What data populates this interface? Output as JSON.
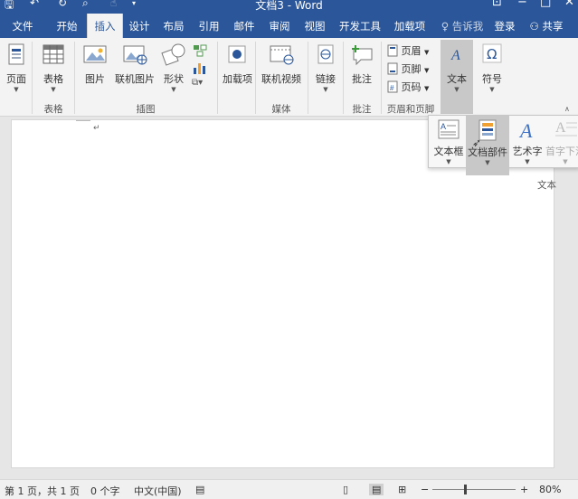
{
  "window": {
    "title": "文档3 - Word"
  },
  "tabs": {
    "file": "文件",
    "home": "开始",
    "insert": "插入",
    "design": "设计",
    "layout": "布局",
    "references": "引用",
    "mailings": "邮件",
    "review": "审阅",
    "view": "视图",
    "developer": "开发工具",
    "addins": "加载项",
    "tellme": "告诉我",
    "signin": "登录",
    "share": "共享"
  },
  "ribbon": {
    "pages": "页面",
    "table": "表格",
    "pictures": "图片",
    "online_pictures": "联机图片",
    "shapes": "形状",
    "addins": "加载项",
    "online_video": "联机视频",
    "links": "链接",
    "comment": "批注",
    "header": "页眉",
    "footer": "页脚",
    "page_number": "页码",
    "text": "文本",
    "symbols": "符号",
    "groups": {
      "tables": "表格",
      "illustrations": "插图",
      "media": "媒体",
      "comments": "批注",
      "header_footer": "页眉和页脚"
    }
  },
  "text_flyout": {
    "text_box": "文本框",
    "quick_parts": "文档部件",
    "wordart": "艺术字",
    "drop_cap": "首字下沉",
    "group": "文本"
  },
  "status": {
    "page": "第 1 页，共 1 页",
    "words": "0 个字",
    "language": "中文(中国)",
    "zoom_minus": "−",
    "zoom_plus": "+",
    "zoom": "80%",
    "zoom_value": 0.8
  },
  "document": {
    "paragraph_mark": "↵"
  },
  "colors": {
    "accent": "#2b579a",
    "highlight": "#c8c8c8",
    "wordart_blue": "#3f72c4"
  }
}
